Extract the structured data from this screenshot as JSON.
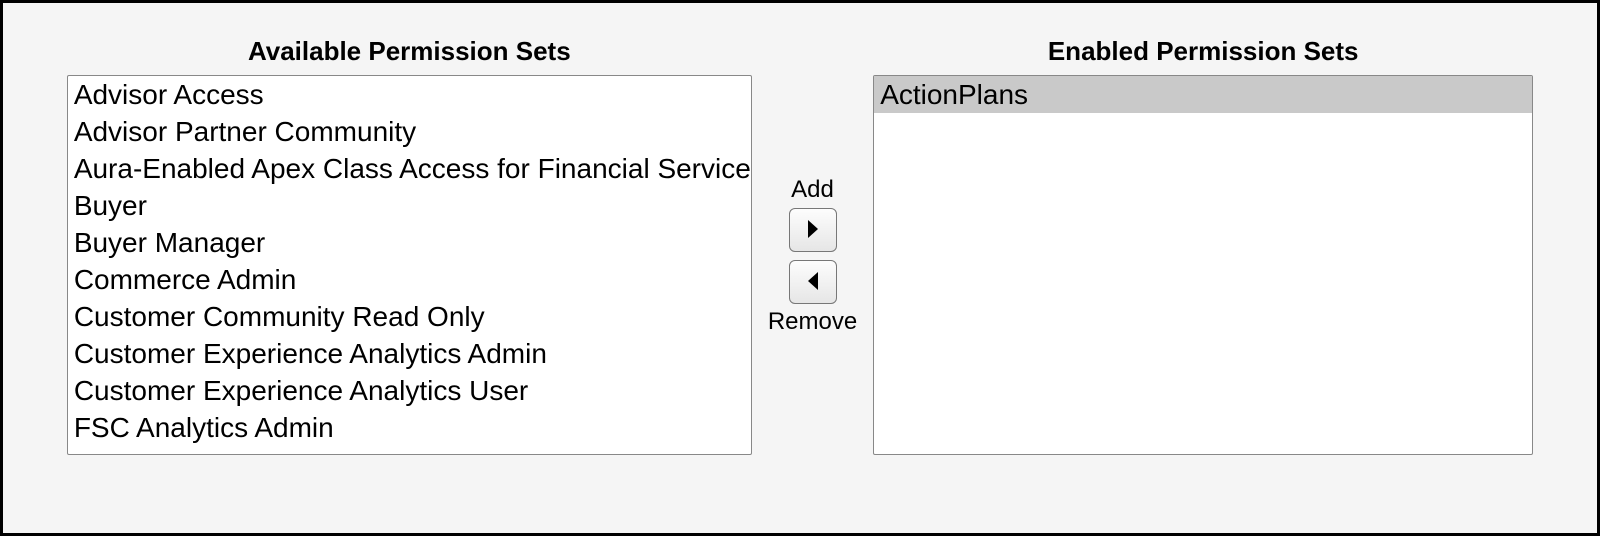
{
  "available": {
    "heading": "Available Permission Sets",
    "items": [
      "Advisor Access",
      "Advisor Partner Community",
      "Aura-Enabled Apex Class Access for Financial Services",
      "Buyer",
      "Buyer Manager",
      "Commerce Admin",
      "Customer Community Read Only",
      "Customer Experience Analytics Admin",
      "Customer Experience Analytics User",
      "FSC Analytics Admin"
    ]
  },
  "enabled": {
    "heading": "Enabled Permission Sets",
    "items": [
      "ActionPlans"
    ],
    "selected_index": 0
  },
  "buttons": {
    "add_label": "Add",
    "remove_label": "Remove"
  }
}
